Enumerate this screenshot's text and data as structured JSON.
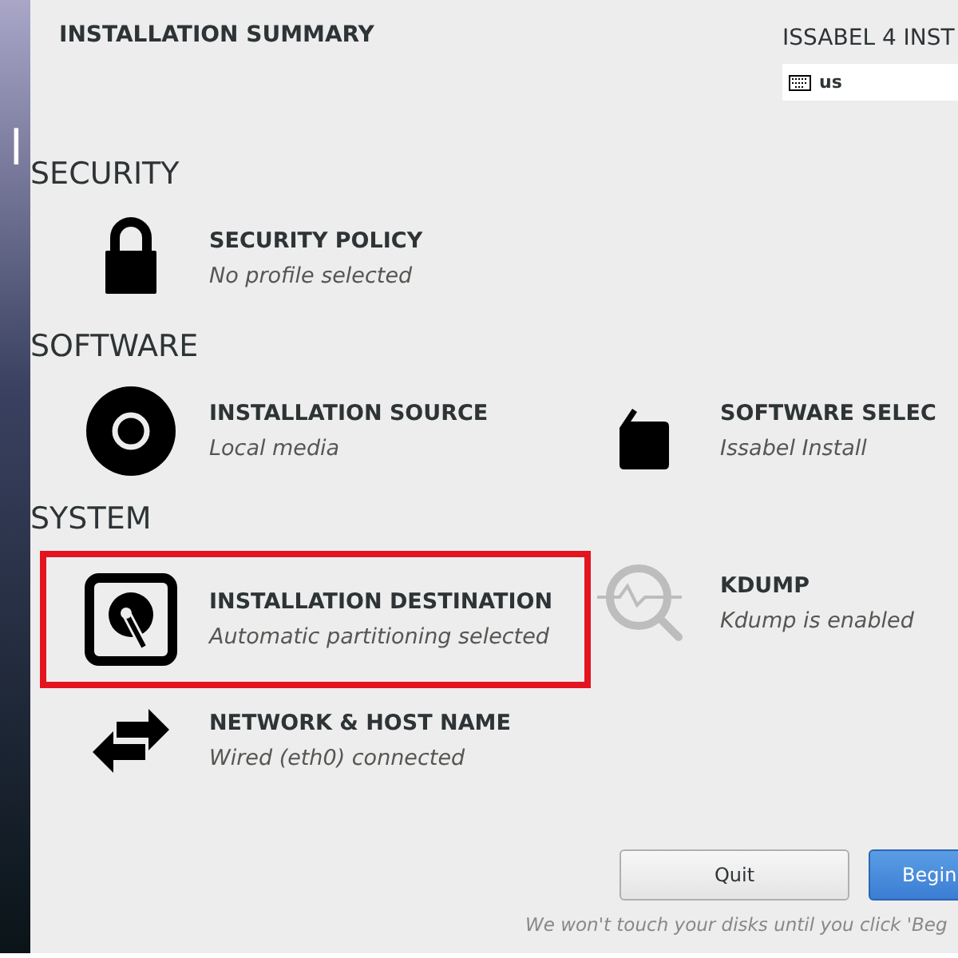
{
  "sidebar": {
    "logo_text": "l"
  },
  "header": {
    "title": "INSTALLATION SUMMARY",
    "product": "ISSABEL 4 INST",
    "keyboard_layout": "us"
  },
  "categories": [
    {
      "heading": "SECURITY",
      "spokes": [
        {
          "kind": "lock",
          "title": "SECURITY POLICY",
          "status": "No profile selected",
          "highlighted": false
        }
      ]
    },
    {
      "heading": "SOFTWARE",
      "spokes": [
        {
          "kind": "disc",
          "title": "INSTALLATION SOURCE",
          "status": "Local media",
          "highlighted": false
        },
        {
          "kind": "package",
          "title": "SOFTWARE SELEC",
          "status": "Issabel Install",
          "highlighted": false
        }
      ]
    },
    {
      "heading": "SYSTEM",
      "spokes": [
        {
          "kind": "disk",
          "title": "INSTALLATION DESTINATION",
          "status": "Automatic partitioning selected",
          "highlighted": true
        },
        {
          "kind": "kdump",
          "title": "KDUMP",
          "status": "Kdump is enabled",
          "highlighted": false
        },
        {
          "kind": "network",
          "title": "NETWORK & HOST NAME",
          "status": "Wired (eth0) connected",
          "highlighted": false
        }
      ]
    }
  ],
  "buttons": [
    {
      "label": "Quit",
      "kind": "secondary"
    },
    {
      "label": "Begin",
      "kind": "primary"
    }
  ],
  "footer_note": "We won't touch your disks until you click 'Beg"
}
